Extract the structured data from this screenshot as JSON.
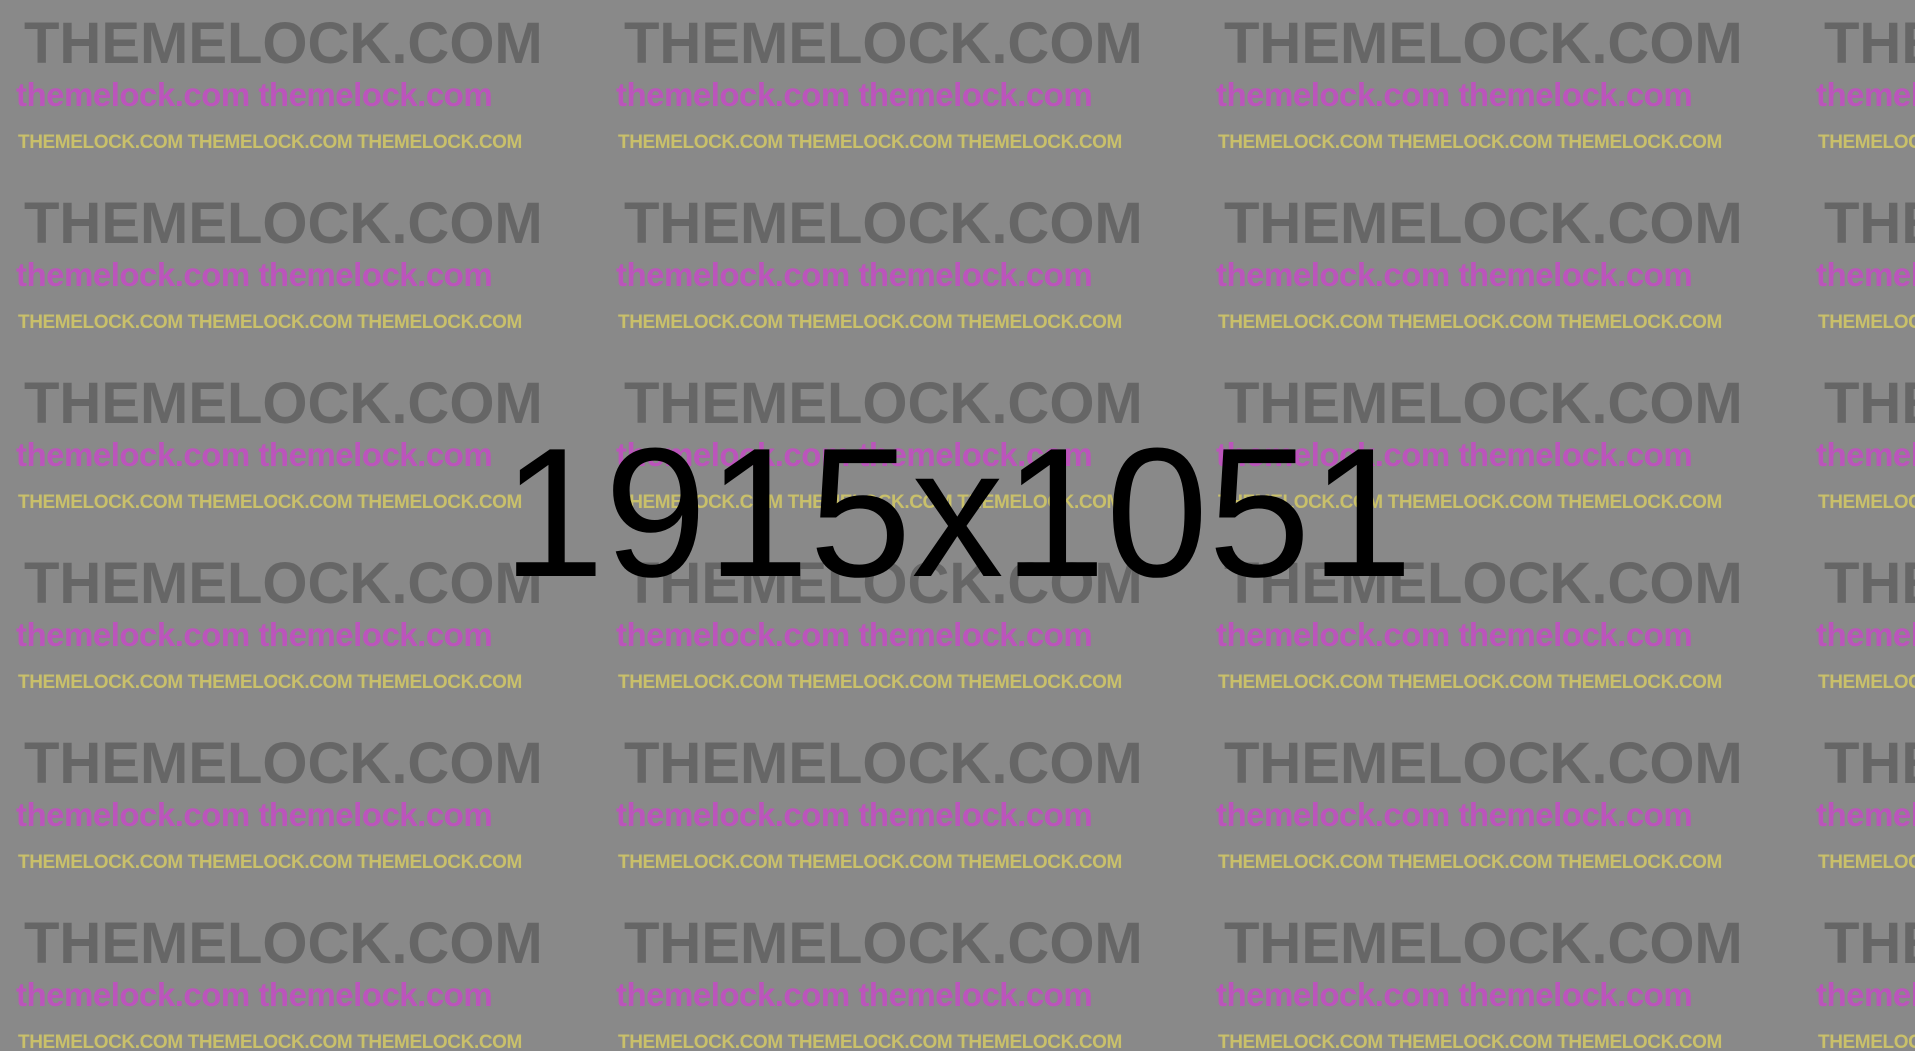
{
  "placeholder": {
    "dimension_label": "1915x1051",
    "background_color": "#898989",
    "label_color": "#000000"
  },
  "watermark": {
    "large_text": "THEMELOCK.COM",
    "medium_text": "themelock.com themelock.com",
    "small_text": "THEMELOCK.COM THEMELOCK.COM THEMELOCK.COM",
    "large_color": "#666666",
    "medium_color": "#bb55bb",
    "small_color": "#c9c06a",
    "rows": 6,
    "columns": 4
  }
}
